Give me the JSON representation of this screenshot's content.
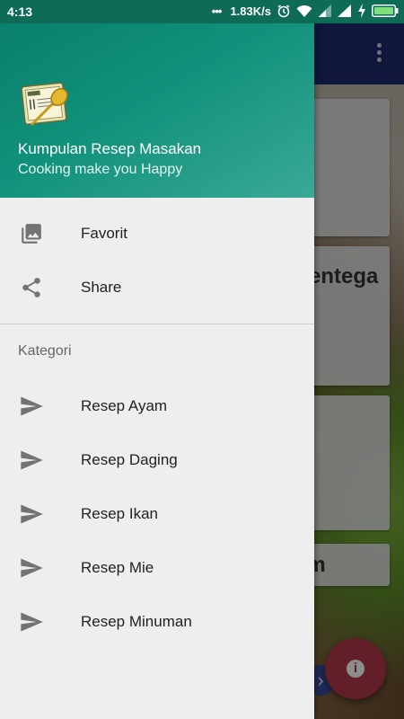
{
  "status_bar": {
    "time": "4:13",
    "more": "•••",
    "speed": "1.83K/s",
    "icons": [
      "alarm-icon",
      "wifi-icon",
      "signal-icon",
      "signal-icon",
      "charging-icon",
      "battery-icon"
    ]
  },
  "background": {
    "cards": [
      "",
      "Mentega",
      "",
      "am"
    ]
  },
  "drawer": {
    "header": {
      "title": "Kumpulan Resep Masakan",
      "subtitle": "Cooking make you Happy"
    },
    "items": [
      {
        "label": "Favorit",
        "icon": "photo-library-icon"
      },
      {
        "label": "Share",
        "icon": "share-icon"
      }
    ],
    "section_title": "Kategori",
    "categories": [
      {
        "label": "Resep Ayam",
        "icon": "send-icon"
      },
      {
        "label": "Resep Daging",
        "icon": "send-icon"
      },
      {
        "label": "Resep Ikan",
        "icon": "send-icon"
      },
      {
        "label": "Resep Mie",
        "icon": "send-icon"
      },
      {
        "label": "Resep Minuman",
        "icon": "send-icon"
      }
    ]
  },
  "colors": {
    "header": "#0b8a72",
    "status_bar": "#0d6b56",
    "toolbar": "#1f2a6e",
    "fab": "#b3384c",
    "drawer_bg": "#eeeeee",
    "icon": "#737373"
  }
}
